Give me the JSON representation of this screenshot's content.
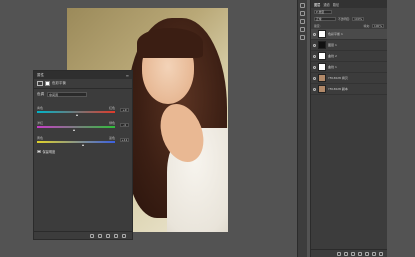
{
  "properties": {
    "tab_label": "属性",
    "menu_glyph": "≡",
    "adjustment_title": "色彩平衡",
    "preset_label": "色调",
    "preset_value": "中间调",
    "sliders": [
      {
        "left": "青色",
        "right": "红色",
        "value": "+0"
      },
      {
        "left": "洋红",
        "right": "绿色",
        "value": "-4"
      },
      {
        "left": "黄色",
        "right": "蓝色",
        "value": "+11"
      }
    ],
    "preserve_luminosity_label": "保留明度"
  },
  "layers_panel": {
    "tabs": [
      "图层",
      "通道",
      "路径"
    ],
    "kind_label": "P 类型",
    "blend_mode": "正常",
    "opacity_label": "不透明度:",
    "opacity_value": "100%",
    "lock_label": "锁定:",
    "fill_label": "填充:",
    "fill_value": "100%",
    "layers": [
      {
        "name": "色彩平衡 1",
        "selected": true,
        "thumb": "#ffffff"
      },
      {
        "name": "图层 1",
        "selected": false,
        "thumb": "#111111"
      },
      {
        "name": "曲线 2",
        "selected": false,
        "thumb": "#ffffff"
      },
      {
        "name": "曲线 1",
        "selected": false,
        "thumb": "#ffffff"
      },
      {
        "name": "YFA3628 拷贝",
        "selected": false,
        "thumb": "#b28a6a"
      },
      {
        "name": "YFA3628 副本",
        "selected": false,
        "thumb": "#b28a6a"
      }
    ]
  },
  "colors": {
    "workspace_bg": "#535353",
    "panel_bg": "#3c3c3c",
    "cyan_red_track": [
      "#00b4c8",
      "#e03a2a"
    ],
    "magenta_green_track": [
      "#c83cc8",
      "#2fbf3a"
    ],
    "yellow_blue_track": [
      "#e0d22a",
      "#3a5fe0"
    ]
  },
  "slider_positions": [
    0.5,
    0.47,
    0.58
  ]
}
